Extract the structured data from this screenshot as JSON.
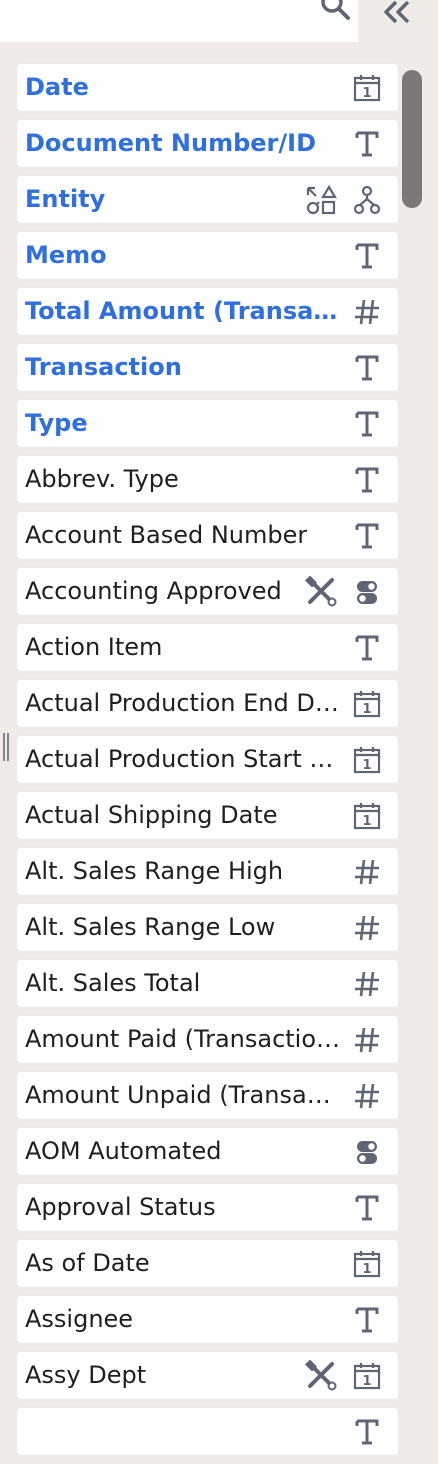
{
  "search": {
    "placeholder": "",
    "value": ""
  },
  "icons": {
    "search": "search-icon",
    "collapse": "double-chevron-left-icon",
    "date": "calendar-icon",
    "text": "text-type-icon",
    "number": "hash-icon",
    "boolean": "toggle-icon",
    "lookup": "shapes-icon",
    "hierarchy": "hierarchy-icon",
    "formula": "tools-icon"
  },
  "colors": {
    "key_field": "#2f6fdf",
    "icon": "#5e6676",
    "background": "#efebe7",
    "row": "#ffffff",
    "scroll_thumb": "#7a7776"
  },
  "fields": [
    {
      "label": "Date",
      "type": "date",
      "key": true
    },
    {
      "label": "Document Number/ID",
      "type": "text",
      "key": true
    },
    {
      "label": "Entity",
      "type": "hierarchy",
      "key": true,
      "extra": "lookup"
    },
    {
      "label": "Memo",
      "type": "text",
      "key": true
    },
    {
      "label": "Total Amount (Transaction Currency)",
      "type": "number",
      "key": true
    },
    {
      "label": "Transaction",
      "type": "text",
      "key": true
    },
    {
      "label": "Type",
      "type": "text",
      "key": true
    },
    {
      "label": "Abbrev. Type",
      "type": "text",
      "key": false
    },
    {
      "label": "Account Based Number",
      "type": "text",
      "key": false
    },
    {
      "label": "Accounting Approved",
      "type": "boolean",
      "key": false,
      "extra": "formula"
    },
    {
      "label": "Action Item",
      "type": "text",
      "key": false
    },
    {
      "label": "Actual Production End Date",
      "type": "date",
      "key": false
    },
    {
      "label": "Actual Production Start Date",
      "type": "date",
      "key": false
    },
    {
      "label": "Actual Shipping Date",
      "type": "date",
      "key": false
    },
    {
      "label": "Alt. Sales Range High",
      "type": "number",
      "key": false
    },
    {
      "label": "Alt. Sales Range Low",
      "type": "number",
      "key": false
    },
    {
      "label": "Alt. Sales Total",
      "type": "number",
      "key": false
    },
    {
      "label": "Amount Paid (Transaction Currency)",
      "type": "number",
      "key": false
    },
    {
      "label": "Amount Unpaid (Transaction Currency)",
      "type": "number",
      "key": false
    },
    {
      "label": "AOM Automated",
      "type": "boolean",
      "key": false
    },
    {
      "label": "Approval Status",
      "type": "text",
      "key": false
    },
    {
      "label": "As of Date",
      "type": "date",
      "key": false
    },
    {
      "label": "Assignee",
      "type": "text",
      "key": false
    },
    {
      "label": "Assy Dept",
      "type": "date",
      "key": false,
      "extra": "formula"
    },
    {
      "label": "",
      "type": "text",
      "key": false
    }
  ]
}
